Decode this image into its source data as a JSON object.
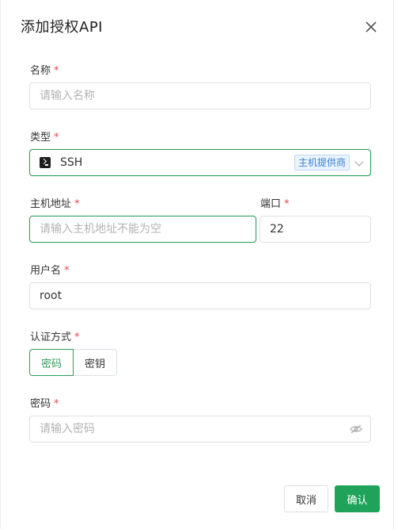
{
  "dialog": {
    "title": "添加授权API",
    "close_icon": "close-icon"
  },
  "form": {
    "required_mark": "*",
    "name": {
      "label": "名称",
      "placeholder": "请输入名称",
      "value": ""
    },
    "type": {
      "label": "类型",
      "value": "SSH",
      "icon": "terminal-icon",
      "badge": "主机提供商"
    },
    "host": {
      "label": "主机地址",
      "placeholder": "请输入主机地址不能为空",
      "value": ""
    },
    "port": {
      "label": "端口",
      "value": "22"
    },
    "username": {
      "label": "用户名",
      "value": "root"
    },
    "auth": {
      "label": "认证方式",
      "options": [
        "密码",
        "密钥"
      ],
      "selected": "密码"
    },
    "password": {
      "label": "密码",
      "placeholder": "请输入密码",
      "value": "",
      "icon": "eye-hidden-icon"
    }
  },
  "footer": {
    "cancel_label": "取消",
    "confirm_label": "确认"
  },
  "colors": {
    "accent": "#1fa35a",
    "required": "#e5484d",
    "badge_text": "#3b7fd1"
  }
}
